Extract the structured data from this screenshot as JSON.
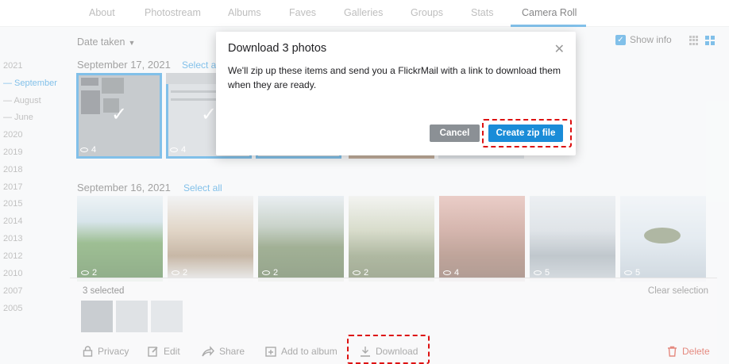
{
  "nav": {
    "tabs": [
      "About",
      "Photostream",
      "Albums",
      "Faves",
      "Galleries",
      "Groups",
      "Stats",
      "Camera Roll"
    ],
    "active_tab": "Camera Roll"
  },
  "toolbar": {
    "sort_label": "Date taken",
    "show_info_label": "Show info"
  },
  "sidebar": {
    "years": [
      "2021",
      "— September",
      "— August",
      "— June",
      "2020",
      "2019",
      "2018",
      "2017",
      "2015",
      "2014",
      "2013",
      "2012",
      "2010",
      "2007",
      "2005"
    ]
  },
  "sections": [
    {
      "date": "September 17, 2021",
      "select_all": "Select all",
      "views": [
        "4",
        "4"
      ]
    },
    {
      "date": "September 16, 2021",
      "select_all": "Select all",
      "views": [
        "2",
        "2",
        "2",
        "2",
        "4",
        "5",
        "5"
      ]
    }
  ],
  "selection_bar": {
    "count_text": "3 selected",
    "clear_label": "Clear selection",
    "actions": {
      "privacy": "Privacy",
      "edit": "Edit",
      "share": "Share",
      "add_to_album": "Add to album",
      "download": "Download",
      "delete": "Delete"
    }
  },
  "modal": {
    "title": "Download 3 photos",
    "body": "We'll zip up these items and send you a FlickrMail with a link to download them when they are ready.",
    "cancel_label": "Cancel",
    "create_label": "Create zip file"
  },
  "colors": {
    "accent": "#1a8cd8",
    "highlight": "#dd1111",
    "delete": "#e58a80"
  }
}
